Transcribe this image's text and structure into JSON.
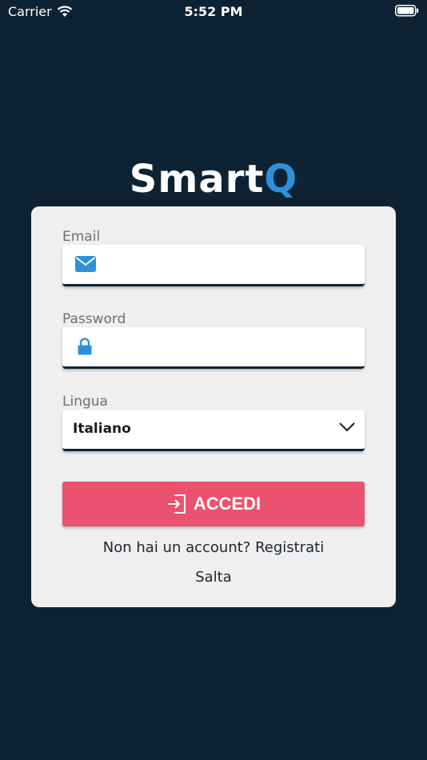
{
  "status_bar": {
    "carrier": "Carrier",
    "time": "5:52 PM"
  },
  "logo": {
    "part1": "Smart",
    "part2": "Q"
  },
  "form": {
    "email_label": "Email",
    "email_value": "",
    "email_icon": "mail-icon",
    "password_label": "Password",
    "password_value": "",
    "password_icon": "lock-icon",
    "language_label": "Lingua",
    "language_value": "Italiano",
    "login_label": "ACCEDI",
    "login_icon": "login-icon",
    "register_text": "Non hai un account? Registrati",
    "skip_text": "Salta"
  },
  "colors": {
    "background": "#0d2334",
    "card": "#efefef",
    "accent": "#2f8fd8",
    "button": "#eb5270"
  }
}
